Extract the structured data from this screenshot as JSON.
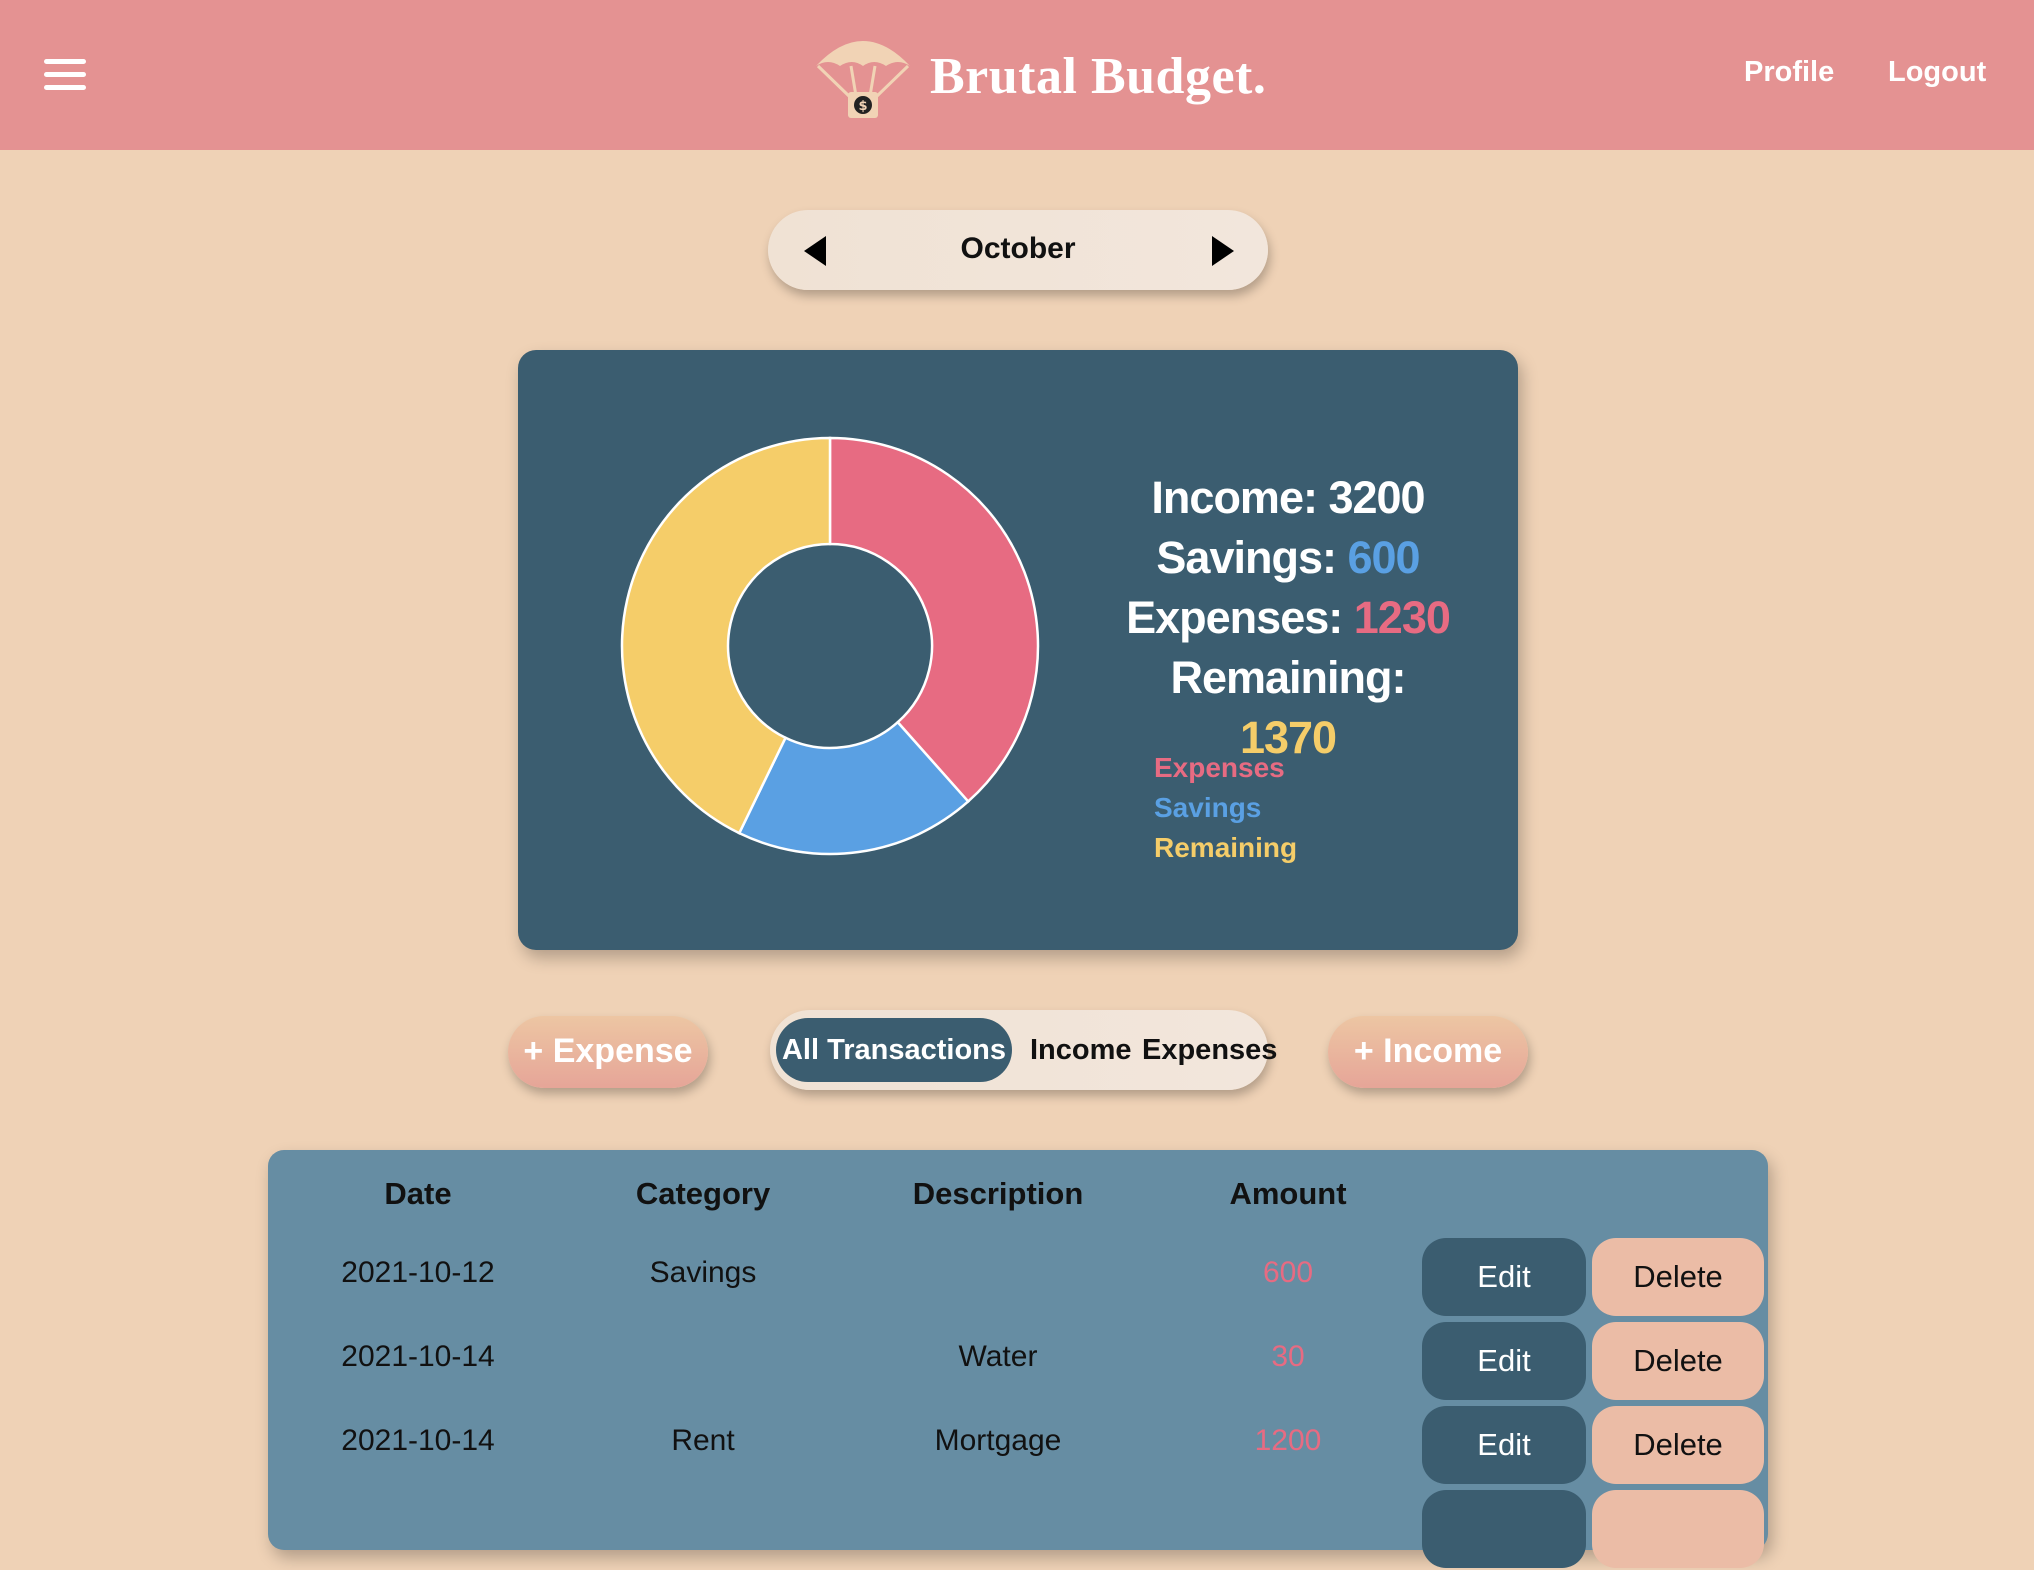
{
  "header": {
    "title": "Brutal Budget.",
    "nav": {
      "profile": "Profile",
      "logout": "Logout"
    },
    "logo_symbol": "$"
  },
  "month_picker": {
    "month": "October"
  },
  "summary": {
    "income_label": "Income:",
    "income_value": "3200",
    "savings_label": "Savings:",
    "savings_value": "600",
    "expenses_label": "Expenses:",
    "expenses_value": "1230",
    "remaining_label": "Remaining:",
    "remaining_value": "1370"
  },
  "chart_data": {
    "type": "pie",
    "style": "donut",
    "categories": [
      "Expenses",
      "Savings",
      "Remaining"
    ],
    "values": [
      1230,
      600,
      1370
    ],
    "colors": [
      "#e76b82",
      "#5aa0e3",
      "#f5cd69"
    ],
    "legend": [
      "Expenses",
      "Savings",
      "Remaining"
    ],
    "legend_position": "right"
  },
  "actions": {
    "add_expense": "+ Expense",
    "add_income": "+ Income"
  },
  "filters": {
    "all": "All Transactions",
    "income": "Income",
    "expenses": "Expenses",
    "active": "All Transactions"
  },
  "table": {
    "headers": {
      "date": "Date",
      "category": "Category",
      "description": "Description",
      "amount": "Amount"
    },
    "edit_label": "Edit",
    "delete_label": "Delete",
    "rows": [
      {
        "date": "2021-10-12",
        "category": "Savings",
        "description": "",
        "amount": "600"
      },
      {
        "date": "2021-10-14",
        "category": "",
        "description": "Water",
        "amount": "30"
      },
      {
        "date": "2021-10-14",
        "category": "Rent",
        "description": "Mortgage",
        "amount": "1200"
      }
    ]
  },
  "colors": {
    "header_bg": "#e49292",
    "page_bg": "#efd2b6",
    "card_bg": "#3b5d70",
    "table_bg": "#668da3",
    "expenses": "#e76b82",
    "savings": "#5aa0e3",
    "remaining": "#f5cd69"
  }
}
